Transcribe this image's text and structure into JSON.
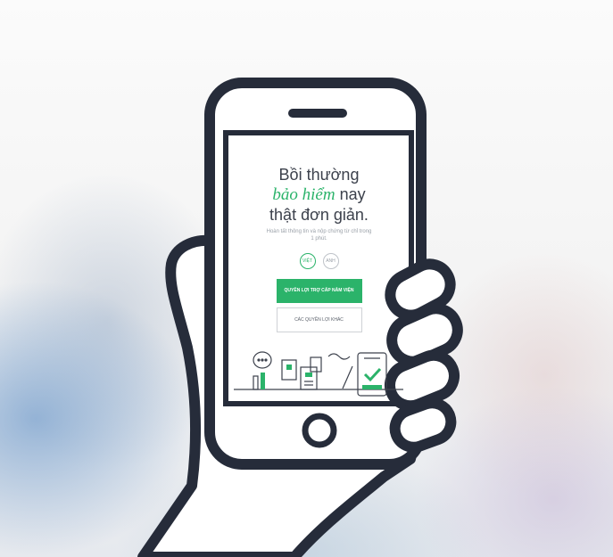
{
  "hero": {
    "headline_line1": "Bồi thường",
    "headline_em": "bảo hiểm",
    "headline_rest": " nay",
    "headline_line3": "thật đơn giản.",
    "subtitle": "Hoàn tất thông tin và nộp chứng từ chỉ trong 1 phút."
  },
  "language": {
    "vietnamese": "VIỆT",
    "english": "ANH",
    "selected": "VIỆT"
  },
  "actions": {
    "primary": "QUYỀN LỢI TRỢ CẤP NẰM VIỆN",
    "secondary": "CÁC QUYỀN LỢI KHÁC"
  },
  "colors": {
    "accent": "#2bb36a",
    "outline": "#262c3a",
    "text": "#3c414c"
  },
  "icons": [
    "speech-bubble-icon",
    "documents-icon",
    "pen-icon",
    "phone-checkmark-icon",
    "home-button-icon",
    "speaker-icon"
  ]
}
